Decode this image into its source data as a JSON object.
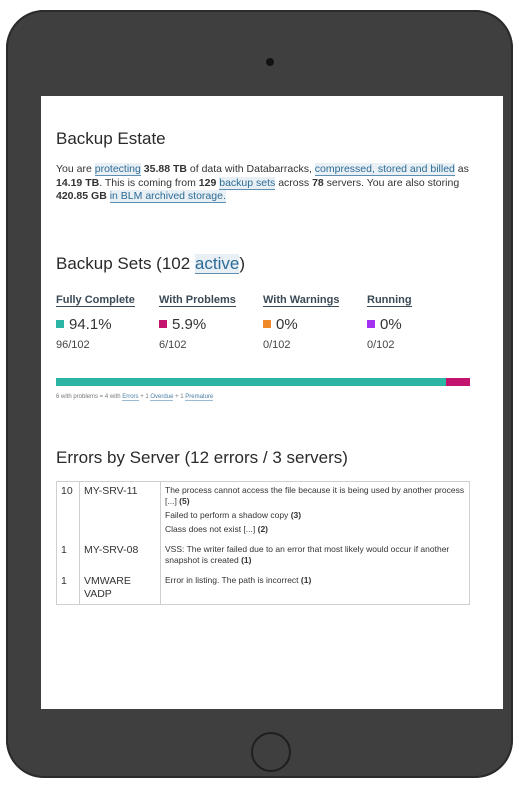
{
  "colors": {
    "fully_complete": "#2bb5a5",
    "with_problems": "#c4126f",
    "with_warnings": "#f0892a",
    "running": "#a232f0"
  },
  "estate": {
    "title": "Backup Estate",
    "p1": "You are ",
    "link_protecting": "protecting",
    "p2": " ",
    "total_data": "35.88 TB",
    "p3": " of data with Databarracks, ",
    "link_compressed": "compressed, stored and billed",
    "p4": " as ",
    "billed": "14.19 TB",
    "p5": ". This is coming from ",
    "sets_count": "129",
    "p6": " ",
    "link_backup_sets": "backup sets",
    "p7": " across ",
    "servers_count": "78",
    "p8": " servers. You are also storing ",
    "blm_size": "420.85 GB",
    "p9": " ",
    "link_blm": "in BLM archived storage."
  },
  "backup_sets": {
    "title_prefix": "Backup Sets (102 ",
    "title_link": "active",
    "title_suffix": ")",
    "stats": [
      {
        "label": "Fully Complete",
        "percent": "94.1%",
        "count": "96/102",
        "fraction": 0.941
      },
      {
        "label": "With Problems",
        "percent": "5.9%",
        "count": "6/102",
        "fraction": 0.059
      },
      {
        "label": "With Warnings",
        "percent": "0%",
        "count": "0/102",
        "fraction": 0
      },
      {
        "label": "Running",
        "percent": "0%",
        "count": "0/102",
        "fraction": 0
      }
    ],
    "note": {
      "t1": "6 with problems = 4 with ",
      "l1": "Errors",
      "t2": " + 1 ",
      "l2": "Overdue",
      "t3": " + 1 ",
      "l3": "Premature"
    }
  },
  "errors": {
    "title": "Errors by Server (12 errors / 3 servers)",
    "rows": [
      {
        "count": "10",
        "server": "MY-SRV-11",
        "messages": [
          {
            "text": "The process cannot access the file because it is being used by another process [...] ",
            "n": "(5)"
          },
          {
            "text": "Failed to perform a shadow copy ",
            "n": "(3)"
          },
          {
            "text": "Class does not exist [...] ",
            "n": "(2)"
          }
        ]
      },
      {
        "count": "1",
        "server": "MY-SRV-08",
        "messages": [
          {
            "text": "VSS: The writer failed due to an error that most likely would occur if another snapshot is created ",
            "n": "(1)"
          }
        ]
      },
      {
        "count": "1",
        "server": "VMWARE VADP",
        "messages": [
          {
            "text": "Error in listing. The path is incorrect ",
            "n": "(1)"
          }
        ]
      }
    ]
  }
}
